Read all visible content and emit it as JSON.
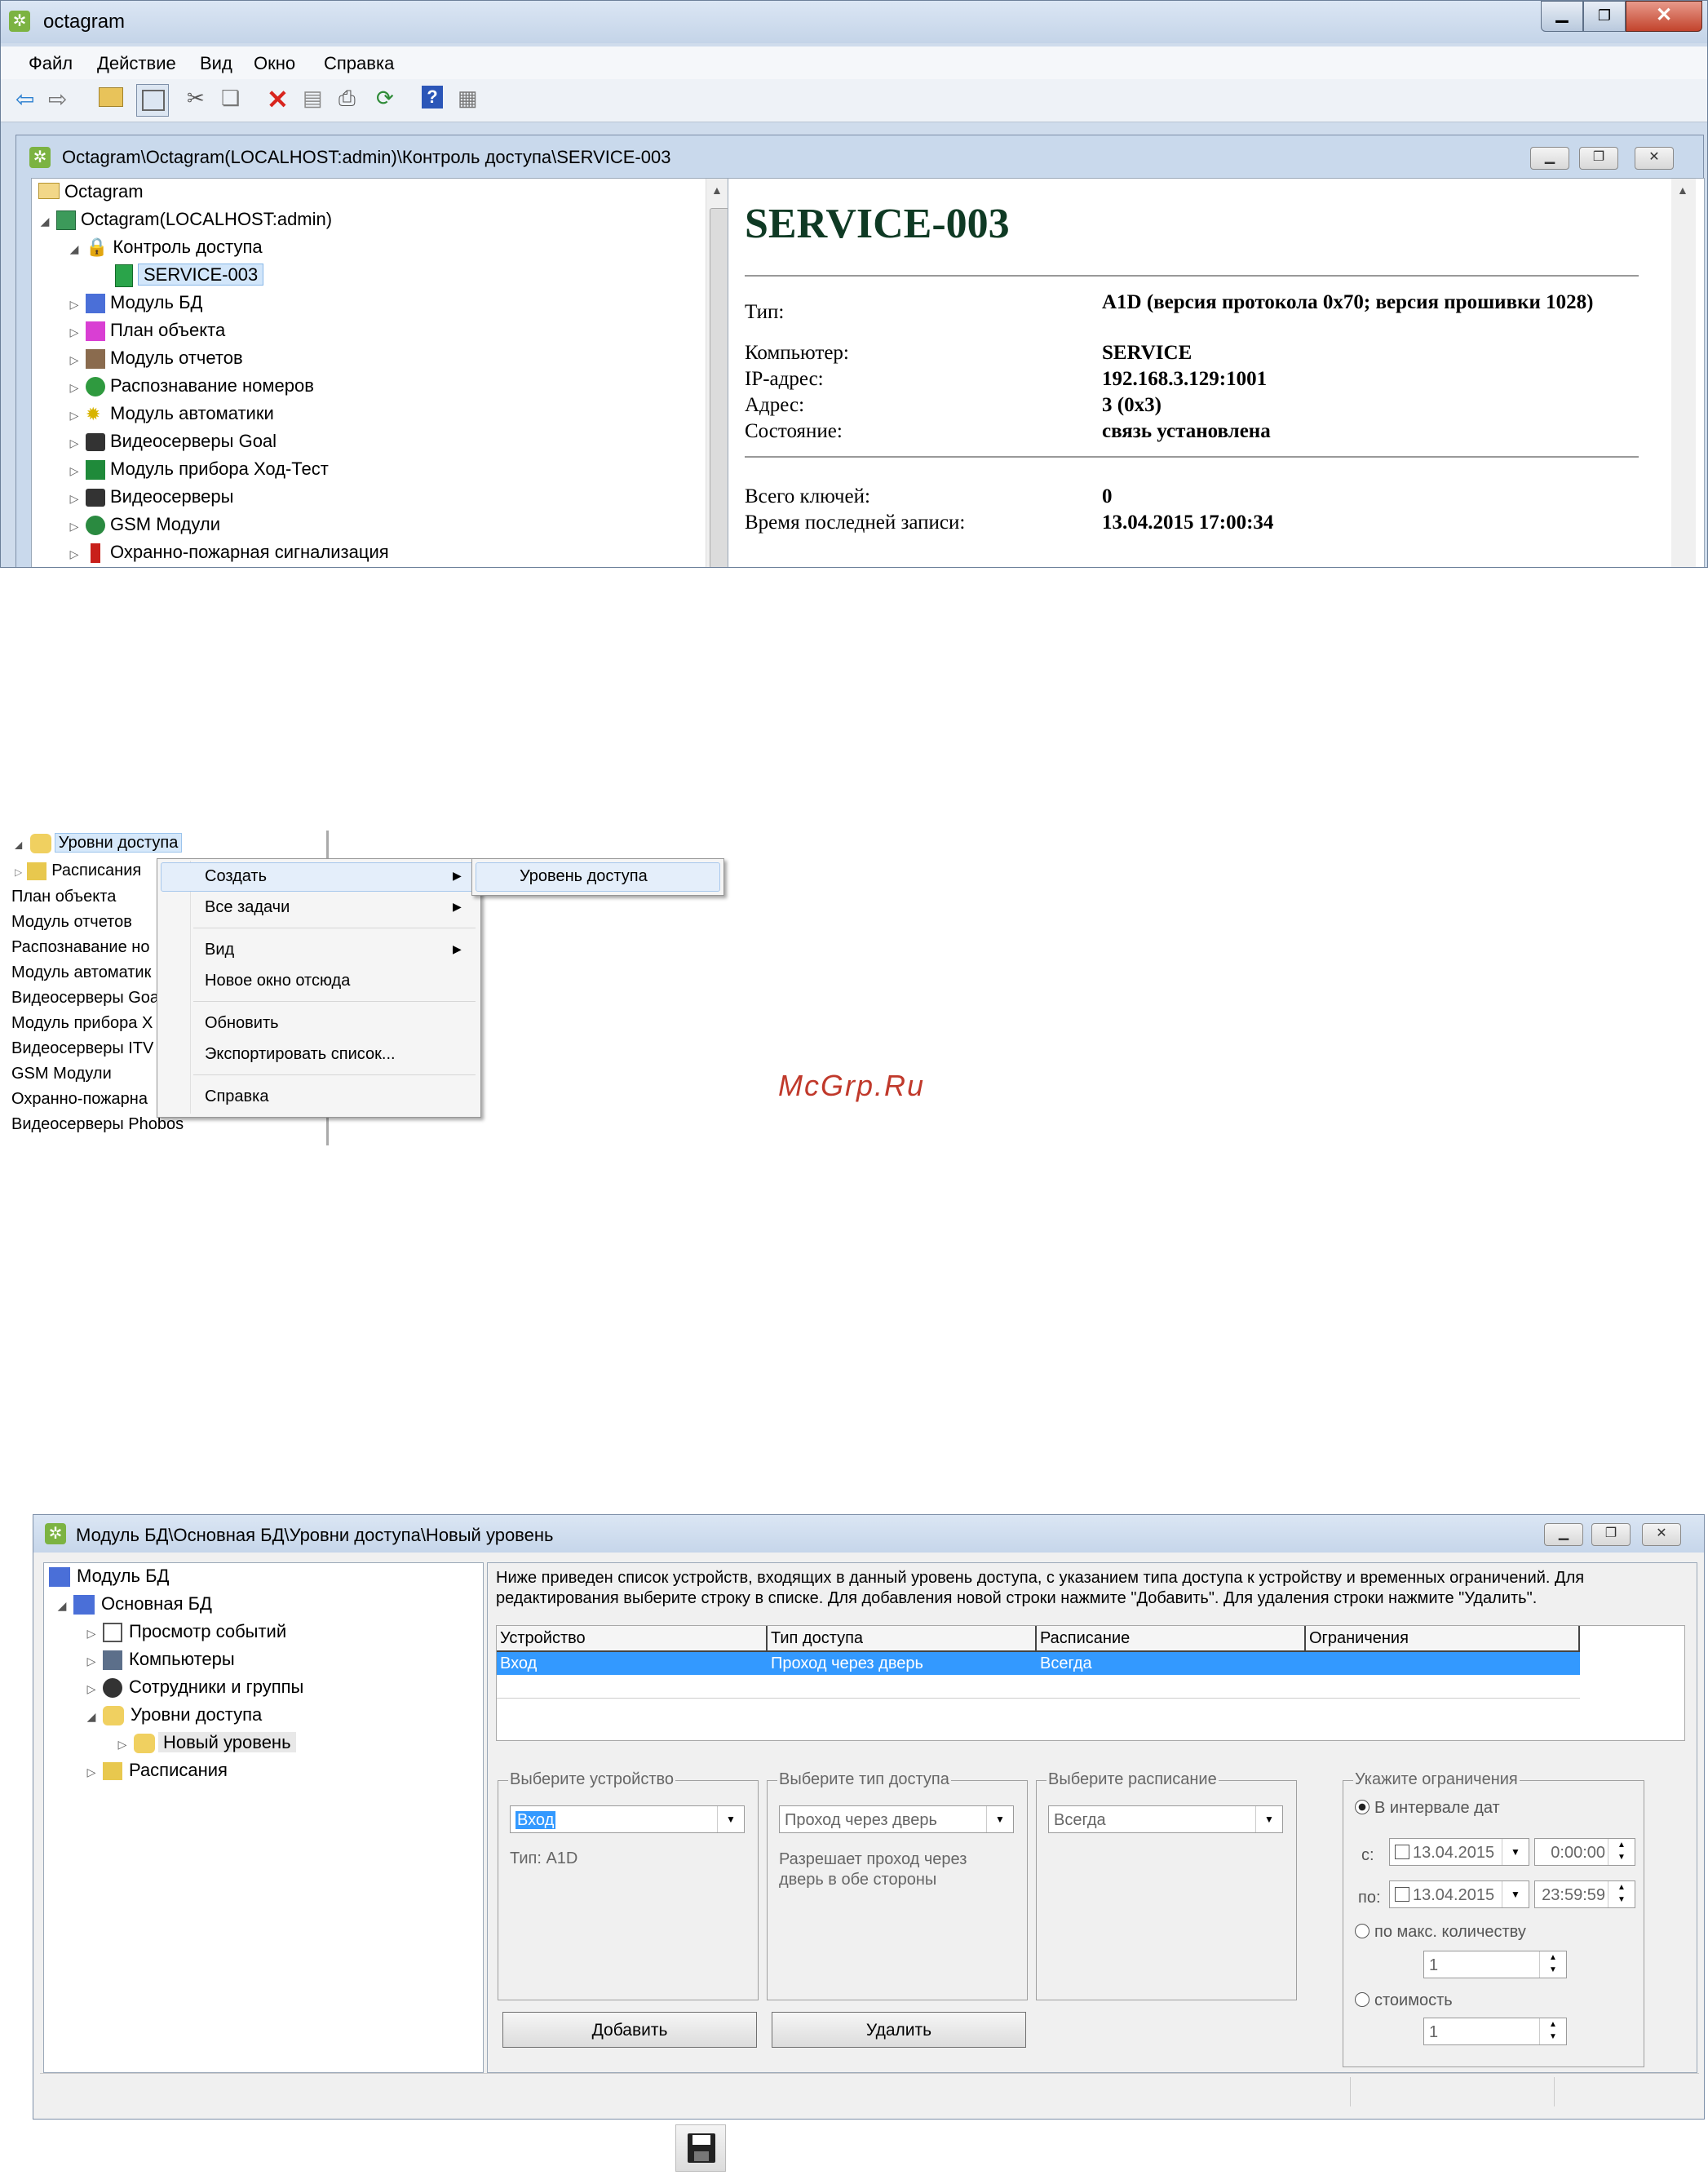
{
  "app": {
    "title": "octagram",
    "menu": [
      "Файл",
      "Действие",
      "Вид",
      "Окно",
      "Справка"
    ],
    "child_window_title": "Octagram\\Octagram(LOCALHOST:admin)\\Контроль доступа\\SERVICE-003",
    "tree": {
      "root": "Octagram",
      "server": "Octagram(LOCALHOST:admin)",
      "access_control": "Контроль доступа",
      "selected": "SERVICE-003",
      "items": [
        "Модуль БД",
        "План объекта",
        "Модуль отчетов",
        "Распознавание номеров",
        "Модуль автоматики",
        "Видеосерверы Goal",
        "Модуль прибора Ход-Тест",
        "Видеосерверы",
        "GSM Модули",
        "Охранно-пожарная сигнализация"
      ]
    },
    "detail": {
      "heading": "SERVICE-003",
      "rows": [
        {
          "label": "Тип:",
          "value": "A1D (версия протокола 0x70; версия прошивки 1028)"
        },
        {
          "label": "Компьютер:",
          "value": "SERVICE"
        },
        {
          "label": "IP-адрес:",
          "value": "192.168.3.129:1001"
        },
        {
          "label": "Адрес:",
          "value": "3 (0x3)"
        },
        {
          "label": "Состояние:",
          "value": "связь установлена"
        }
      ],
      "rows2": [
        {
          "label": "Всего ключей:",
          "value": "0"
        },
        {
          "label": "Время последней записи:",
          "value": "13.04.2015 17:00:34"
        }
      ]
    }
  },
  "context": {
    "tree_items": [
      "Уровни доступа",
      "Расписания",
      "План объекта",
      "Модуль отчетов",
      "Распознавание но",
      "Модуль автоматик",
      "Видеосерверы Goa",
      "Модуль прибора Х",
      "Видеосерверы ITV",
      "GSM Модули",
      "Охранно-пожарна",
      "Видеосерверы Phobos"
    ],
    "menu": [
      "Создать",
      "Все задачи",
      "Вид",
      "Новое окно отсюда",
      "Обновить",
      "Экспортировать список...",
      "Справка"
    ],
    "submenu": "Уровень доступа"
  },
  "watermark": "McGrp.Ru",
  "db": {
    "title": "Модуль БД\\Основная БД\\Уровни доступа\\Новый уровень",
    "tree": [
      "Модуль БД",
      "Основная БД",
      "Просмотр событий",
      "Компьютеры",
      "Сотрудники и группы",
      "Уровни доступа",
      "Новый уровень",
      "Расписания"
    ],
    "info": "Ниже приведен список устройств, входящих в данный уровень доступа, с указанием типа доступа к устройству и временных ограничений. Для редактирования выберите строку в списке. Для добавления новой строки нажмите \"Добавить\". Для удаления строки нажмите \"Удалить\".",
    "columns": [
      "Устройство",
      "Тип доступа",
      "Расписание",
      "Ограничения"
    ],
    "row": [
      "Вход",
      "Проход через дверь",
      "Всегда",
      ""
    ],
    "device": {
      "label": "Выберите устройство",
      "value": "Вход",
      "type": "Тип: A1D"
    },
    "access_type": {
      "label": "Выберите тип доступа",
      "value": "Проход через дверь",
      "desc": "Разрешает проход через дверь в обе стороны"
    },
    "schedule": {
      "label": "Выберите расписание",
      "value": "Всегда"
    },
    "limits": {
      "label": "Укажите ограничения",
      "interval": "В интервале дат",
      "from_label": "с:",
      "from_date": "13.04.2015",
      "from_time": "0:00:00",
      "to_label": "по:",
      "to_date": "13.04.2015",
      "to_time": "23:59:59",
      "max_count": "по макс. количеству",
      "count_value": "1",
      "cost": "стоимость",
      "cost_value": "1"
    },
    "add_button": "Добавить",
    "delete_button": "Удалить"
  },
  "icons": [
    "back-icon",
    "forward-icon",
    "up-folder-icon",
    "show-tree-icon",
    "cut-icon",
    "copy-icon",
    "delete-icon",
    "properties-icon",
    "print-icon",
    "refresh-icon",
    "help-icon",
    "view-icon",
    "save-icon"
  ]
}
